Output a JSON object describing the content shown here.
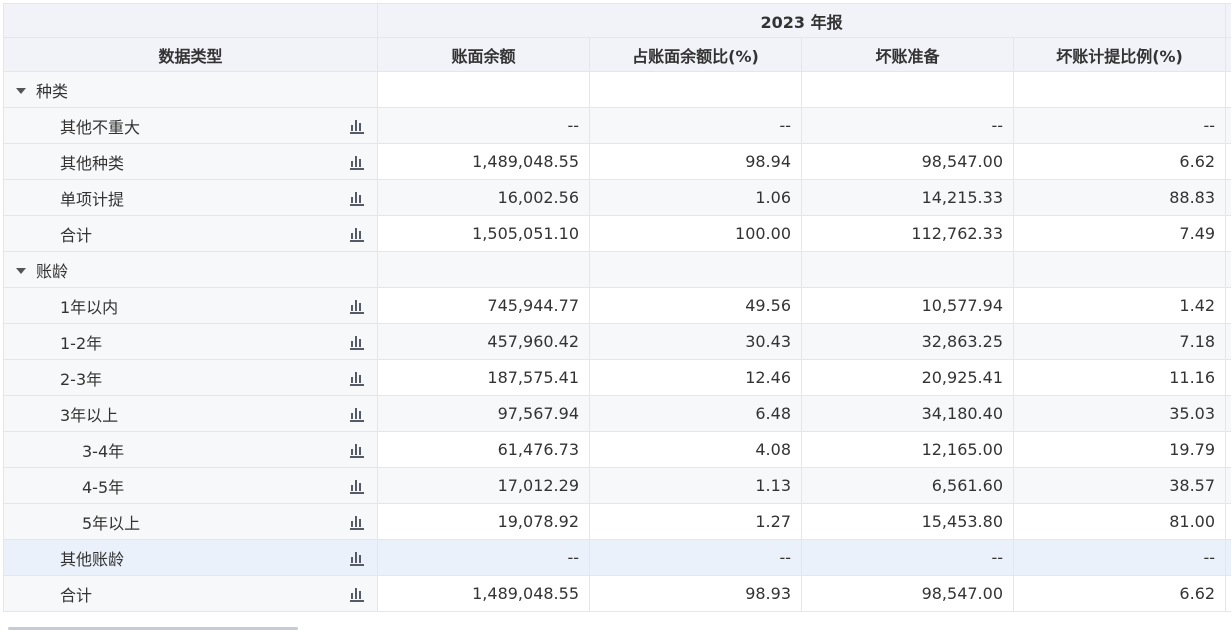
{
  "header": {
    "year_report": "2023 年报",
    "col_type": "数据类型",
    "col_balance": "账面余额",
    "col_ratio": "占账面余额比(%)",
    "col_provision": "坏账准备",
    "col_prov_ratio": "坏账计提比例(%)"
  },
  "groups": [
    {
      "label": "种类",
      "rows": [
        {
          "label": "其他不重大",
          "balance": "--",
          "ratio": "--",
          "provision": "--",
          "prov_ratio": "--"
        },
        {
          "label": "其他种类",
          "balance": "1,489,048.55",
          "ratio": "98.94",
          "provision": "98,547.00",
          "prov_ratio": "6.62"
        },
        {
          "label": "单项计提",
          "balance": "16,002.56",
          "ratio": "1.06",
          "provision": "14,215.33",
          "prov_ratio": "88.83"
        },
        {
          "label": "合计",
          "balance": "1,505,051.10",
          "ratio": "100.00",
          "provision": "112,762.33",
          "prov_ratio": "7.49"
        }
      ]
    },
    {
      "label": "账龄",
      "rows": [
        {
          "label": "1年以内",
          "balance": "745,944.77",
          "ratio": "49.56",
          "provision": "10,577.94",
          "prov_ratio": "1.42"
        },
        {
          "label": "1-2年",
          "balance": "457,960.42",
          "ratio": "30.43",
          "provision": "32,863.25",
          "prov_ratio": "7.18"
        },
        {
          "label": "2-3年",
          "balance": "187,575.41",
          "ratio": "12.46",
          "provision": "20,925.41",
          "prov_ratio": "11.16"
        },
        {
          "label": "3年以上",
          "balance": "97,567.94",
          "ratio": "6.48",
          "provision": "34,180.40",
          "prov_ratio": "35.03"
        },
        {
          "label": "3-4年",
          "balance": "61,476.73",
          "ratio": "4.08",
          "provision": "12,165.00",
          "prov_ratio": "19.79"
        },
        {
          "label": "4-5年",
          "balance": "17,012.29",
          "ratio": "1.13",
          "provision": "6,561.60",
          "prov_ratio": "38.57"
        },
        {
          "label": "5年以上",
          "balance": "19,078.92",
          "ratio": "1.27",
          "provision": "15,453.80",
          "prov_ratio": "81.00"
        },
        {
          "label": "其他账龄",
          "balance": "--",
          "ratio": "--",
          "provision": "--",
          "prov_ratio": "--"
        },
        {
          "label": "合计",
          "balance": "1,489,048.55",
          "ratio": "98.93",
          "provision": "98,547.00",
          "prov_ratio": "6.62"
        }
      ]
    }
  ],
  "icons": {
    "chart": "bar-chart-icon",
    "expand": "caret-down-icon"
  },
  "colors": {
    "header_bg": "#f1f3f8",
    "alt_row_bg": "#f7f8fa",
    "highlight_row_bg": "#eaf1fb",
    "icon": "#555a66"
  }
}
